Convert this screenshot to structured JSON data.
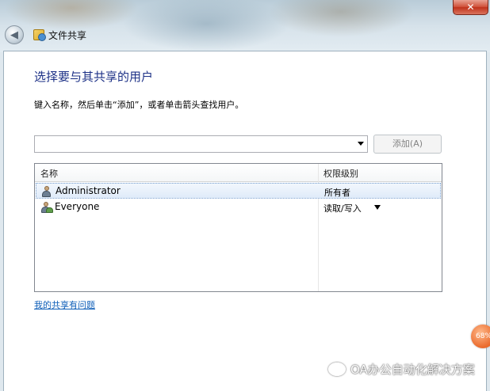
{
  "window": {
    "title": "文件共享",
    "close_label": "✕"
  },
  "dialog": {
    "heading": "选择要与其共享的用户",
    "instruction": "键入名称，然后单击“添加”，或者单击箭头查找用户。",
    "combo_value": "",
    "add_button": "添加(A)",
    "columns": {
      "name": "名称",
      "permission": "权限级别"
    },
    "users": [
      {
        "name": "Administrator",
        "permission": "所有者",
        "icon": "user-icon",
        "selected": true
      },
      {
        "name": "Everyone",
        "permission": "读取/写入",
        "icon": "group-icon",
        "selected": false
      }
    ],
    "help_link": "我的共享有问题"
  },
  "overlay": {
    "badge": "68%",
    "watermark": "OA办公自动化解决方案"
  },
  "colors": {
    "heading": "#1e3287",
    "link": "#0e5eb8",
    "close": "#c0321b"
  }
}
